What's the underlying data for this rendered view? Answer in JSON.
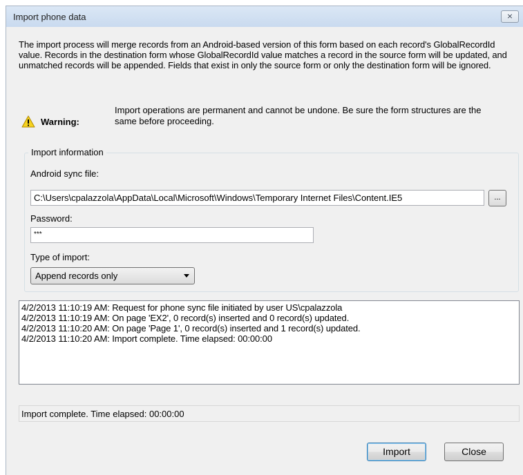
{
  "window": {
    "title": "Import phone data",
    "close_glyph": "⨯"
  },
  "intro": "The import process will merge records from an Android-based version of this form based on each record's GlobalRecordId value. Records in the destination form whose GlobalRecordId value matches a record in the source form will be updated, and unmatched records will be appended. Fields that exist in only the source form or only the destination form will be ignored.",
  "warning": {
    "icon": "warning-triangle-icon",
    "label": "Warning:",
    "text": "Import operations are permanent and cannot be undone. Be sure the form structures are the same before proceeding."
  },
  "import_info": {
    "legend": "Import information",
    "sync_file_label": "Android sync file:",
    "sync_file_value": "C:\\Users\\cpalazzola\\AppData\\Local\\Microsoft\\Windows\\Temporary Internet Files\\Content.IE5",
    "browse_label": "...",
    "password_label": "Password:",
    "password_value": "***",
    "type_label": "Type of import:",
    "type_value": "Append records only"
  },
  "log": [
    "4/2/2013 11:10:19 AM: Request for phone sync file initiated by user US\\cpalazzola",
    "4/2/2013 11:10:19 AM: On page 'EX2', 0 record(s) inserted and 0 record(s) updated.",
    "4/2/2013 11:10:20 AM: On page 'Page 1', 0 record(s) inserted and 1 record(s) updated.",
    "4/2/2013 11:10:20 AM: Import complete. Time elapsed: 00:00:00"
  ],
  "status": "Import complete. Time elapsed: 00:00:00",
  "buttons": {
    "import": "Import",
    "close": "Close"
  },
  "colors": {
    "dialog_bg": "#f0f0f0",
    "titlebar": "#dbe7f5",
    "warning_fill": "#f7d31e",
    "default_button_border": "#3c7fb1"
  }
}
